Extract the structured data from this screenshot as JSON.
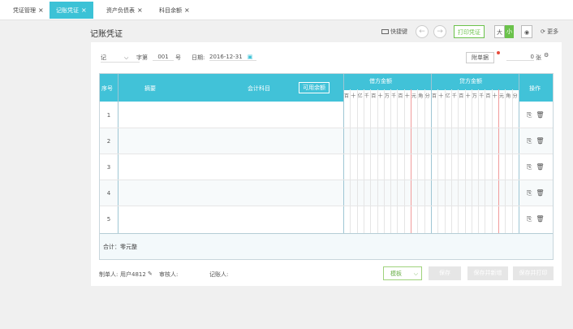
{
  "tabs": [
    {
      "label": "凭证管理",
      "active": false
    },
    {
      "label": "记账凭证",
      "active": true
    },
    {
      "label": "资产负债表",
      "active": false
    },
    {
      "label": "科目余额",
      "active": false
    }
  ],
  "header": {
    "title": "记账凭证",
    "shortcut_label": "快捷键",
    "print_label": "打印凭证",
    "size_a_label": "大",
    "size_b_label": "小",
    "more_label": "更多"
  },
  "voucher": {
    "word_label": "记",
    "no_label": "字第",
    "no_value": "001",
    "no_unit": "号",
    "date_label": "日期:",
    "date_value": "2016-12-31",
    "attach_label": "附单据",
    "attach_count": "0",
    "attach_unit": "张"
  },
  "table": {
    "col_index": "序号",
    "col_summary": "摘要",
    "col_account": "会计科目",
    "col_account_btn": "可用余额",
    "col_debit": "借方金额",
    "col_credit": "贷方金额",
    "col_ops": "操作",
    "digits": [
      "百",
      "十",
      "亿",
      "千",
      "百",
      "十",
      "万",
      "千",
      "百",
      "十",
      "元",
      "角",
      "分"
    ],
    "rows": [
      "1",
      "2",
      "3",
      "4",
      "5"
    ],
    "total_label": "合计：零元整"
  },
  "footer": {
    "maker_label": "制单人:",
    "maker_value": "用户4812",
    "auditor_label": "审核人:",
    "auditor_value": "",
    "bookkeeper_label": "记账人:",
    "bookkeeper_value": "",
    "template_label": "模板",
    "save_label": "保存",
    "save_new_label": "保存并新增",
    "save_print_label": "保存并打印"
  },
  "colors": {
    "accent": "#41c2d8",
    "green": "#6bc24b",
    "red": "#f19b9b"
  }
}
